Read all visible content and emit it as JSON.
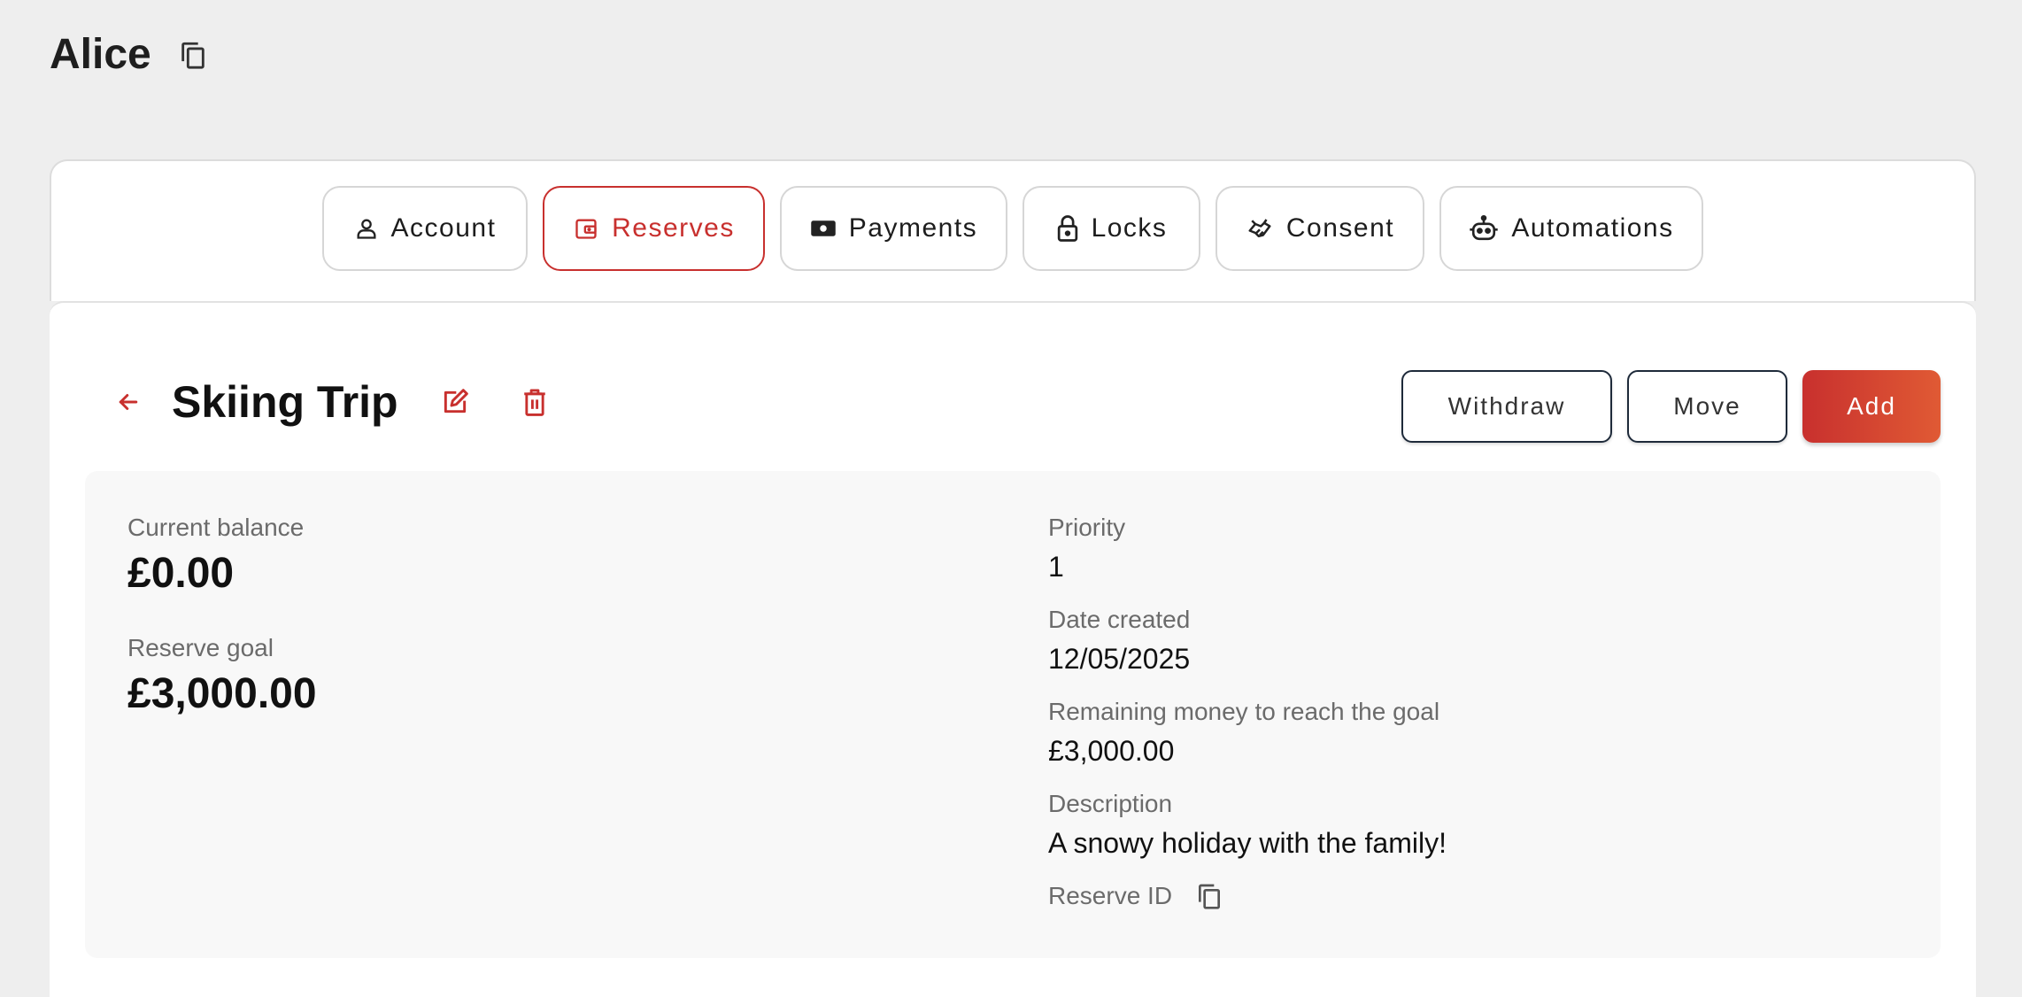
{
  "header": {
    "title": "Alice",
    "copy_icon": "copy-icon"
  },
  "tabs": [
    {
      "label": "Account",
      "icon": "person-icon",
      "active": false
    },
    {
      "label": "Reserves",
      "icon": "wallet-icon",
      "active": true
    },
    {
      "label": "Payments",
      "icon": "banknote-icon",
      "active": false
    },
    {
      "label": "Locks",
      "icon": "lock-icon",
      "active": false
    },
    {
      "label": "Consent",
      "icon": "handshake-icon",
      "active": false
    },
    {
      "label": "Automations",
      "icon": "robot-icon",
      "active": false
    }
  ],
  "reserve": {
    "title": "Skiing Trip",
    "actions": {
      "withdraw": "Withdraw",
      "move": "Move",
      "add": "Add"
    },
    "current_balance_label": "Current balance",
    "current_balance": "£0.00",
    "goal_label": "Reserve goal",
    "goal": "£3,000.00",
    "priority_label": "Priority",
    "priority": "1",
    "date_created_label": "Date created",
    "date_created": "12/05/2025",
    "remaining_label": "Remaining money to reach the goal",
    "remaining": "£3,000.00",
    "description_label": "Description",
    "description": "A snowy holiday with the family!",
    "reserve_id_label": "Reserve ID"
  },
  "colors": {
    "accent": "#c8302e",
    "accent_end": "#e05a34",
    "background": "#eeeeee"
  }
}
